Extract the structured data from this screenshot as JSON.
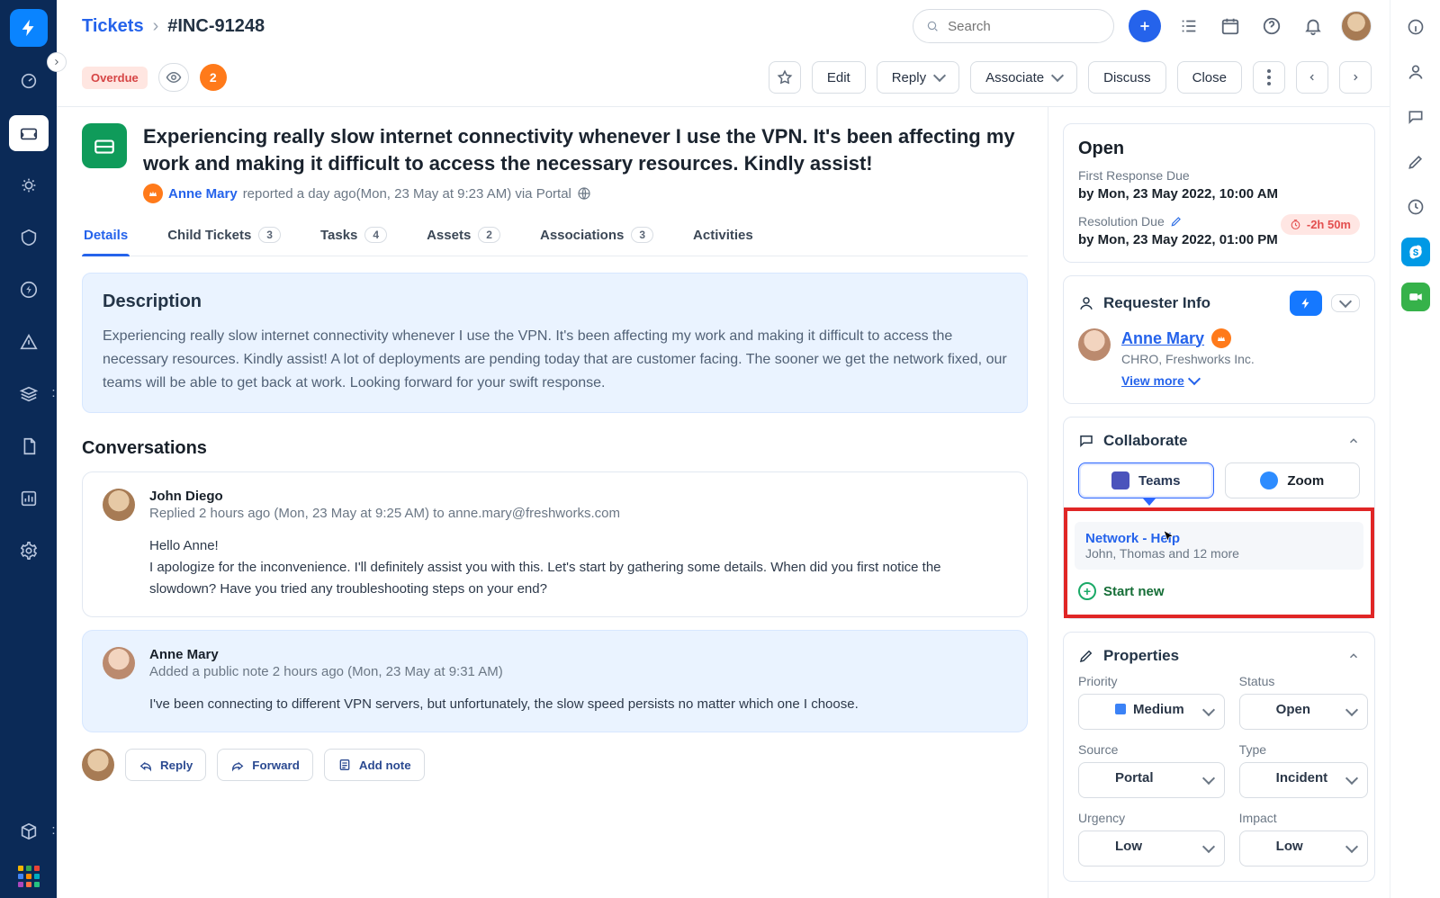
{
  "breadcrumb": {
    "root": "Tickets",
    "id": "#INC-91248"
  },
  "search": {
    "placeholder": "Search"
  },
  "status_row": {
    "overdue": "Overdue",
    "watchers": "2"
  },
  "actions": {
    "edit": "Edit",
    "reply": "Reply",
    "associate": "Associate",
    "discuss": "Discuss",
    "close": "Close"
  },
  "ticket": {
    "title": "Experiencing really slow internet connectivity whenever I use the VPN. It's been affecting my work and making it difficult to access the necessary resources. Kindly assist!",
    "reporter": "Anne Mary",
    "reported_meta": "reported a day ago(Mon, 23 May at 9:23 AM) via Portal"
  },
  "tabs": {
    "details": "Details",
    "child": "Child Tickets",
    "child_count": "3",
    "tasks": "Tasks",
    "tasks_count": "4",
    "assets": "Assets",
    "assets_count": "2",
    "assoc": "Associations",
    "assoc_count": "3",
    "activities": "Activities"
  },
  "description": {
    "heading": "Description",
    "body": "Experiencing really slow internet connectivity whenever I use the VPN. It's been affecting my work and making it difficult to access the necessary resources. Kindly assist! A lot of deployments are pending today that are customer facing. The sooner we get the network fixed, our teams will be able to get back at work. Looking forward for your swift response."
  },
  "conversations_heading": "Conversations",
  "conversations": [
    {
      "author": "John Diego",
      "meta": "Replied 2 hours ago (Mon, 23 May at 9:25 AM) to anne.mary@freshworks.com",
      "body": "Hello Anne!\nI apologize for the inconvenience. I'll definitely assist you with this. Let's start by gathering some details. When did you first notice the slowdown? Have you tried any troubleshooting steps on your end?"
    },
    {
      "author": "Anne Mary",
      "meta": "Added a public note 2 hours ago (Mon, 23 May at 9:31 AM)",
      "body": "I've been connecting to different VPN servers, but unfortunately, the slow speed persists no matter which one I choose."
    }
  ],
  "reply_bar": {
    "reply": "Reply",
    "forward": "Forward",
    "add_note": "Add note"
  },
  "sidebar": {
    "open_card": {
      "title": "Open",
      "first_label": "First Response Due",
      "first_value": "by Mon, 23 May 2022, 10:00 AM",
      "res_label": "Resolution Due",
      "res_value": "by Mon, 23 May 2022, 01:00 PM",
      "overdue_chip": "-2h 50m"
    },
    "requester": {
      "heading": "Requester Info",
      "name": "Anne Mary",
      "role": "CHRO, Freshworks Inc.",
      "view_more": "View more"
    },
    "collaborate": {
      "heading": "Collaborate",
      "teams": "Teams",
      "zoom": "Zoom",
      "thread_title": "Network - Help",
      "thread_sub": "John, Thomas and 12 more",
      "start_new": "Start new"
    },
    "properties": {
      "heading": "Properties",
      "priority": {
        "label": "Priority",
        "value": "Medium"
      },
      "status": {
        "label": "Status",
        "value": "Open"
      },
      "source": {
        "label": "Source",
        "value": "Portal"
      },
      "type": {
        "label": "Type",
        "value": "Incident"
      },
      "urgency": {
        "label": "Urgency",
        "value": "Low"
      },
      "impact": {
        "label": "Impact",
        "value": "Low"
      }
    }
  }
}
